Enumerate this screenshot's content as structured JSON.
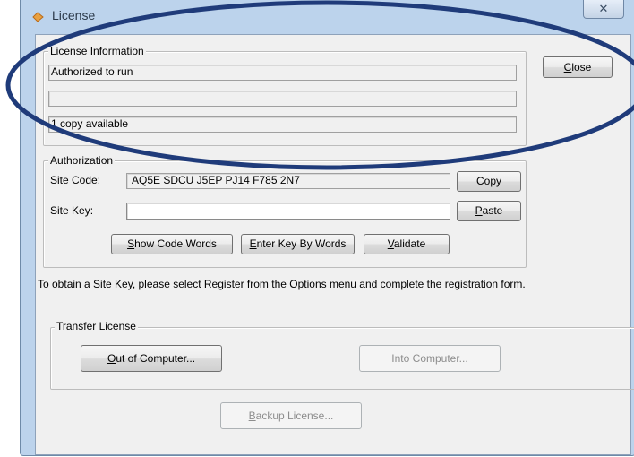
{
  "window": {
    "title": "License",
    "close_glyph": "✕"
  },
  "license_info": {
    "group_label": "License Information",
    "status": "Authorized to run",
    "line2": "",
    "copies": "1 copy available"
  },
  "close_button": {
    "mnemonic": "C",
    "rest": "lose"
  },
  "authorization": {
    "group_label": "Authorization",
    "site_code_label": "Site Code:",
    "site_code_value": "AQ5E SDCU J5EP PJ14 F785 2N7",
    "site_key_label": "Site Key:",
    "site_key_value": "",
    "copy_button": "Copy",
    "paste_button": {
      "mnemonic": "P",
      "rest": "aste"
    },
    "show_code_words": {
      "mnemonic": "S",
      "rest": "how Code Words"
    },
    "enter_key_by_words": {
      "mnemonic": "E",
      "rest": "nter Key By Words"
    },
    "validate": {
      "mnemonic": "V",
      "rest": "alidate"
    }
  },
  "instructions": "To obtain a Site Key, please select Register from the Options menu and complete the registration form.",
  "transfer": {
    "group_label": "Transfer License",
    "out_of_computer": {
      "mnemonic": "O",
      "rest": "ut of Computer..."
    },
    "into_computer": "Into Computer..."
  },
  "backup": {
    "mnemonic": "B",
    "rest": "ackup License..."
  },
  "annotation": {
    "color": "#1f3b7a"
  },
  "icons": [
    "app-icon",
    "close-icon"
  ]
}
